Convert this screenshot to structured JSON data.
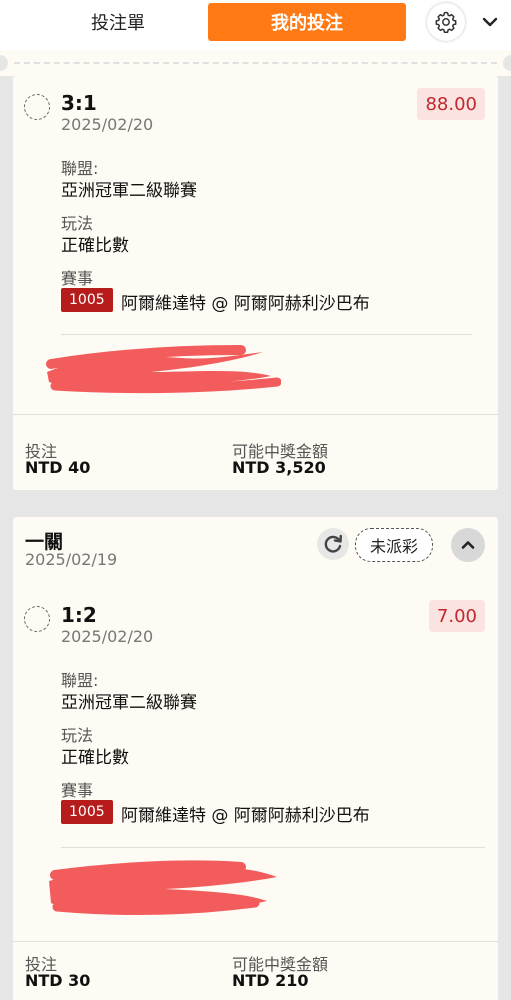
{
  "header": {
    "tab_betslip": "投注單",
    "tab_mybets": "我的投注"
  },
  "bets": [
    {
      "score": "3:1",
      "date": "2025/02/20",
      "odds": "88.00",
      "league_label": "聯盟:",
      "league": "亞洲冠軍二級聯賽",
      "play_label": "玩法",
      "play": "正確比數",
      "event_label": "賽事",
      "event_code": "1005",
      "event_name": "阿爾維達特 @ 阿爾阿赫利沙巴布",
      "stake_label": "投注",
      "stake": "NTD 40",
      "payout_label": "可能中獎金額",
      "payout": "NTD 3,520"
    },
    {
      "score": "1:2",
      "date": "2025/02/20",
      "odds": "7.00",
      "league_label": "聯盟:",
      "league": "亞洲冠軍二級聯賽",
      "play_label": "玩法",
      "play": "正確比數",
      "event_label": "賽事",
      "event_code": "1005",
      "event_name": "阿爾維達特 @ 阿爾阿赫利沙巴布",
      "stake_label": "投注",
      "stake": "NTD 30",
      "payout_label": "可能中獎金額",
      "payout": "NTD 210"
    }
  ],
  "group2": {
    "title": "一關",
    "date": "2025/02/19",
    "status": "未派彩"
  },
  "colors": {
    "accent": "#ff7a14",
    "odds_bg": "#fbe3e1",
    "odds_text": "#c0282c",
    "event_code_bg": "#b71c1c",
    "redaction": "#f25c5c"
  },
  "icons": [
    "gear-icon",
    "chevron-down-icon",
    "refresh-icon",
    "chevron-up-icon",
    "radio-circle-icon"
  ]
}
